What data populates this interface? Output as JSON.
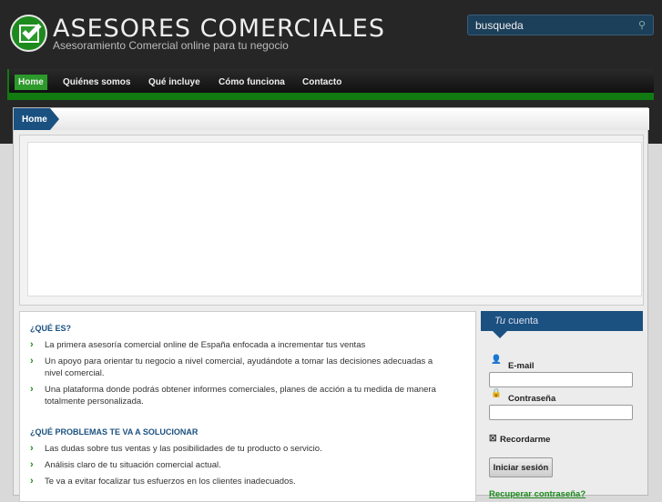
{
  "header": {
    "title": "ASESORES COMERCIALES",
    "tagline": "Asesoramiento Comercial online para tu negocio",
    "search_value": "busqueda"
  },
  "nav": [
    "Home",
    "Quiénes somos",
    "Qué incluye",
    "Cómo funciona",
    "Contacto"
  ],
  "breadcrumb": "Home",
  "main": {
    "sections": [
      {
        "title": "¿QUÉ ES?",
        "items": [
          "La primera asesoría comercial online de España enfocada a incrementar tus ventas",
          "Un apoyo para orientar tu negocio a nivel comercial, ayudándote a tomar las decisiones adecuadas a nivel comercial.",
          "Una plataforma donde podrás obtener informes comerciales, planes de acción a tu medida de manera totalmente personalizada."
        ]
      },
      {
        "title": "¿QUÉ PROBLEMAS TE VA A SOLUCIONAR",
        "items": [
          "Las dudas sobre tus ventas y las posibilidades de tu producto o servicio.",
          "Análisis claro de tu situación comercial actual.",
          "Te va a evitar focalizar tus esfuerzos en los clientes inadecuados."
        ]
      }
    ]
  },
  "login": {
    "title_em": "Tu",
    "title_rest": " cuenta",
    "email_label": "E-mail",
    "password_label": "Contraseña",
    "remember_label": "Recordarme",
    "submit": "Iniciar sesión",
    "forgot": "Recuperar contraseña?"
  }
}
